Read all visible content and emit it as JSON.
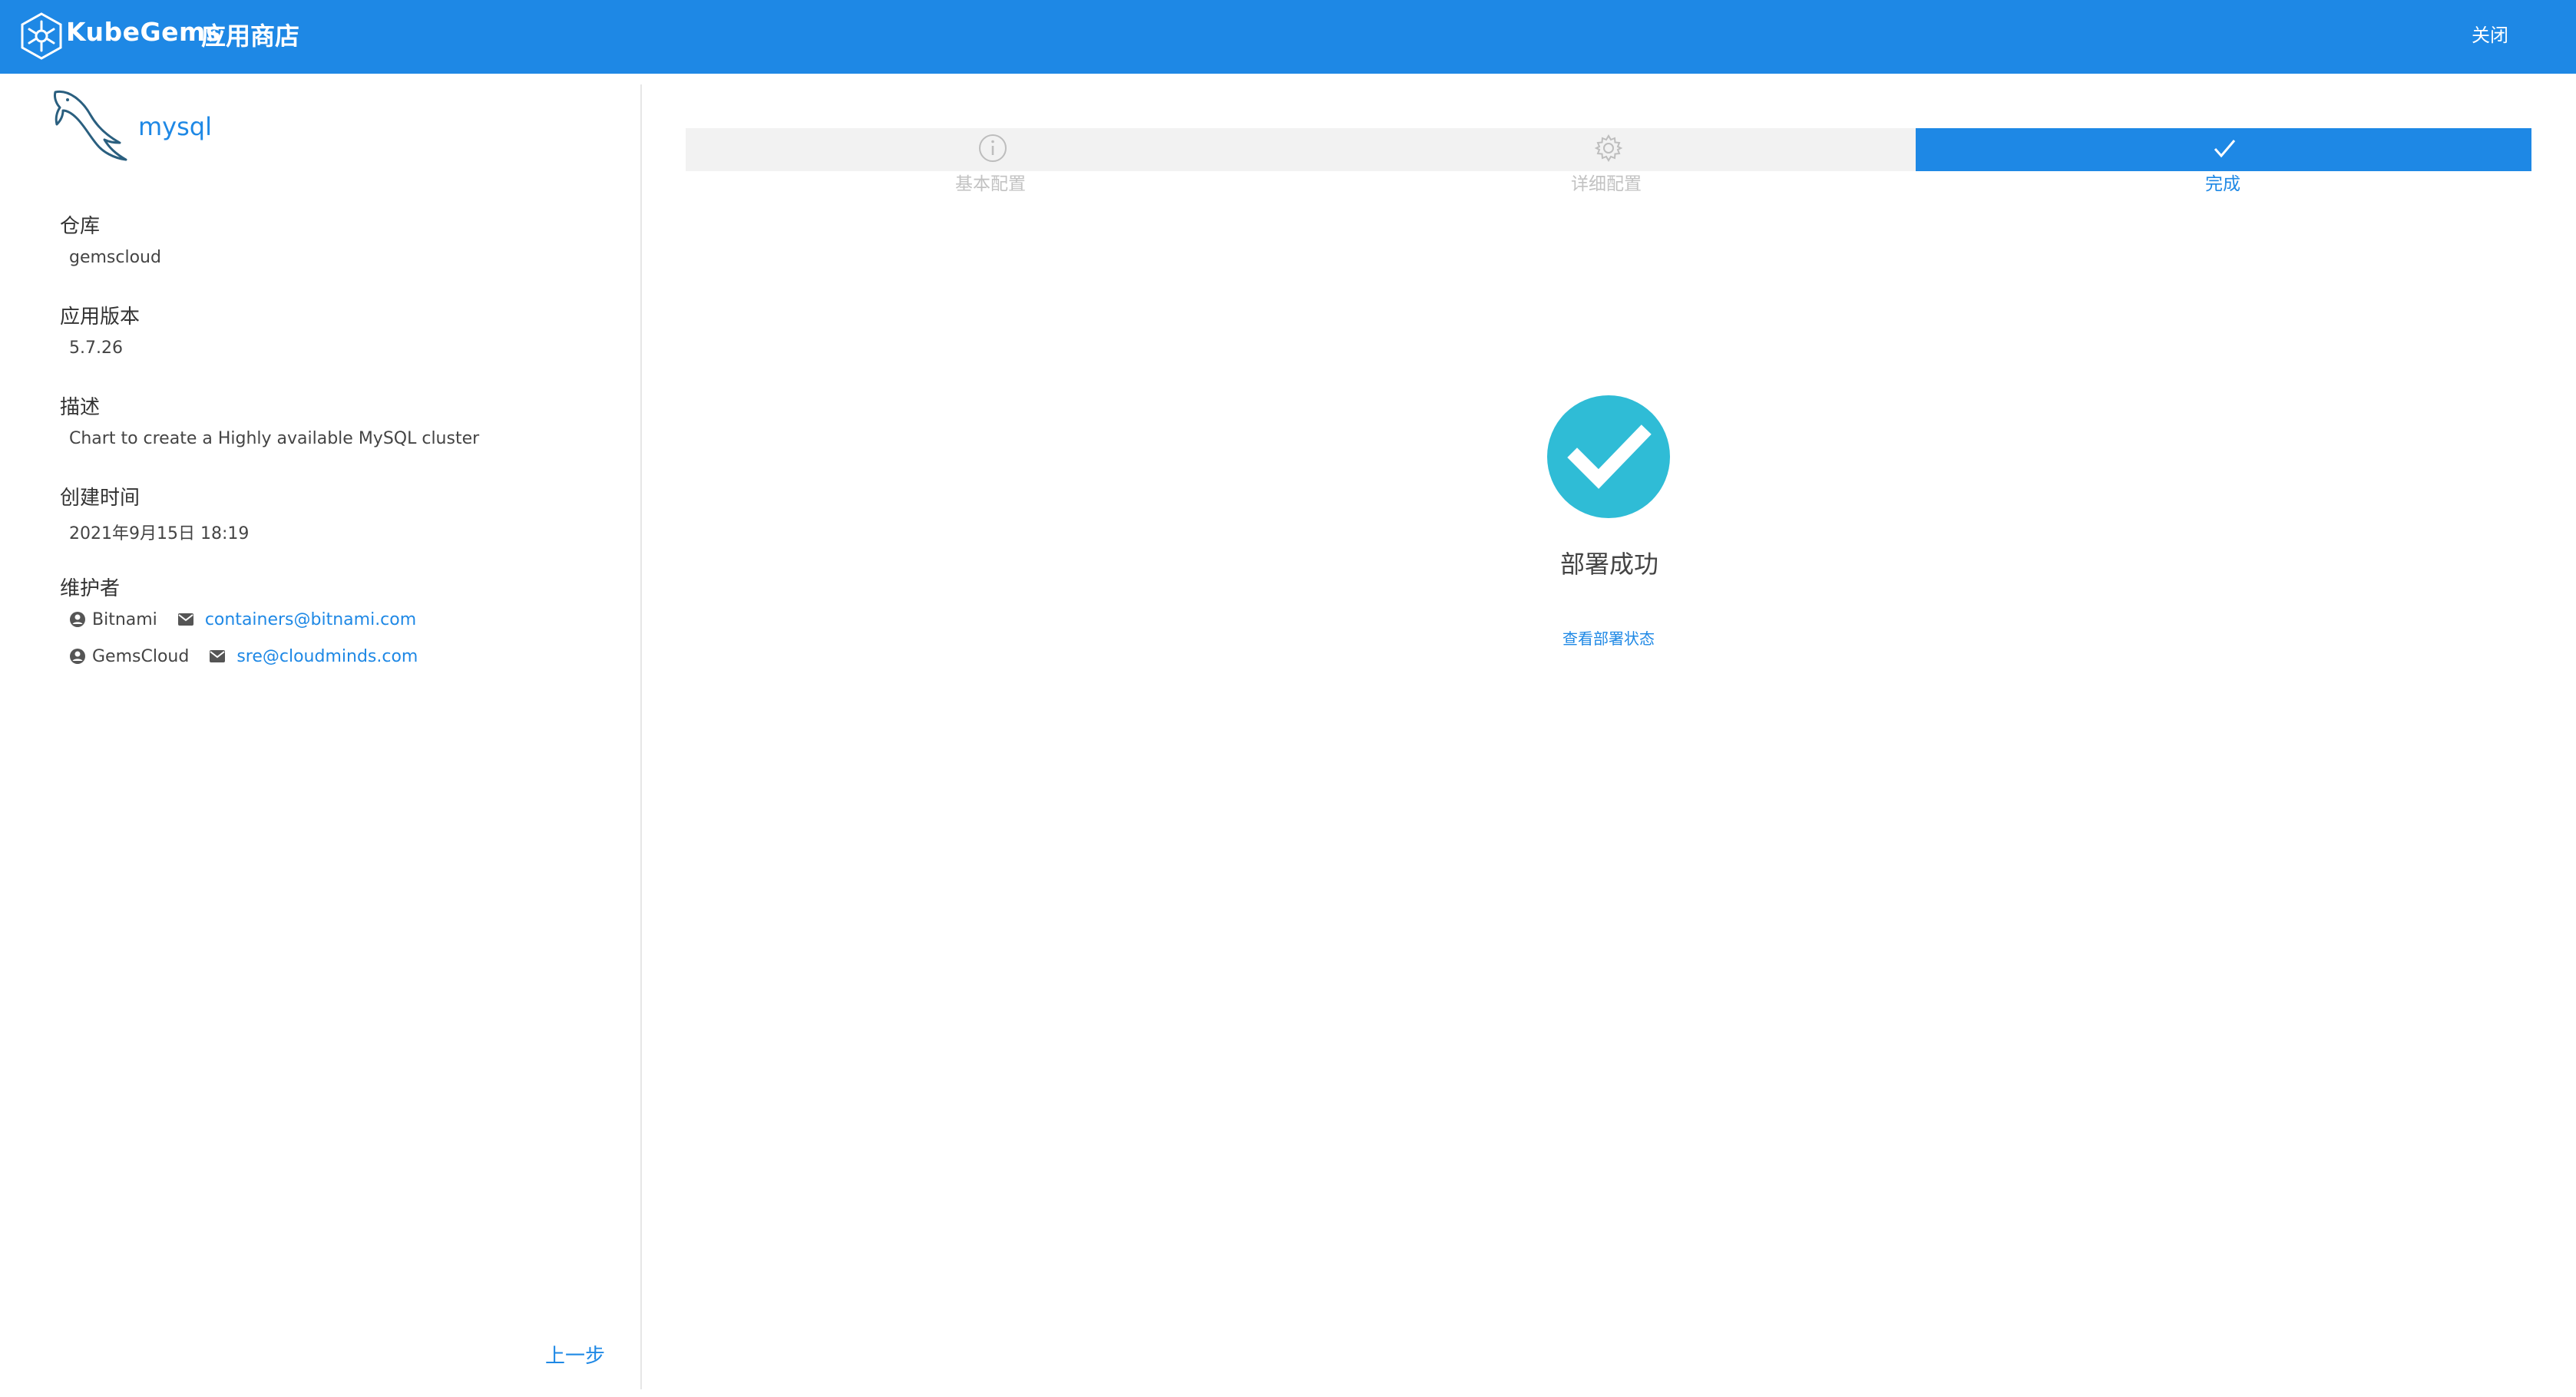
{
  "header": {
    "brand": "KubeGems",
    "title": "应用商店",
    "close_label": "关闭"
  },
  "app": {
    "name": "mysql",
    "fields": {
      "repo_label": "仓库",
      "repo_value": "gemscloud",
      "version_label": "应用版本",
      "version_value": "5.7.26",
      "desc_label": "描述",
      "desc_value": "Chart to create a Highly available MySQL cluster",
      "created_label": "创建时间",
      "created_value": "2021年9月15日 18:19",
      "maintainers_label": "维护者"
    },
    "maintainers": [
      {
        "name": "Bitnami",
        "email": "containers@bitnami.com"
      },
      {
        "name": "GemsCloud",
        "email": "sre@cloudminds.com"
      }
    ],
    "prev_label": "上一步"
  },
  "steps": [
    {
      "label": "基本配置",
      "icon": "info-icon",
      "active": false
    },
    {
      "label": "详细配置",
      "icon": "gear-icon",
      "active": false
    },
    {
      "label": "完成",
      "icon": "check-icon",
      "active": true
    }
  ],
  "result": {
    "message": "部署成功",
    "link_label": "查看部署状态"
  },
  "colors": {
    "primary": "#1e88e5",
    "success": "#2fbcd6",
    "step_inactive": "#f2f2f2"
  }
}
